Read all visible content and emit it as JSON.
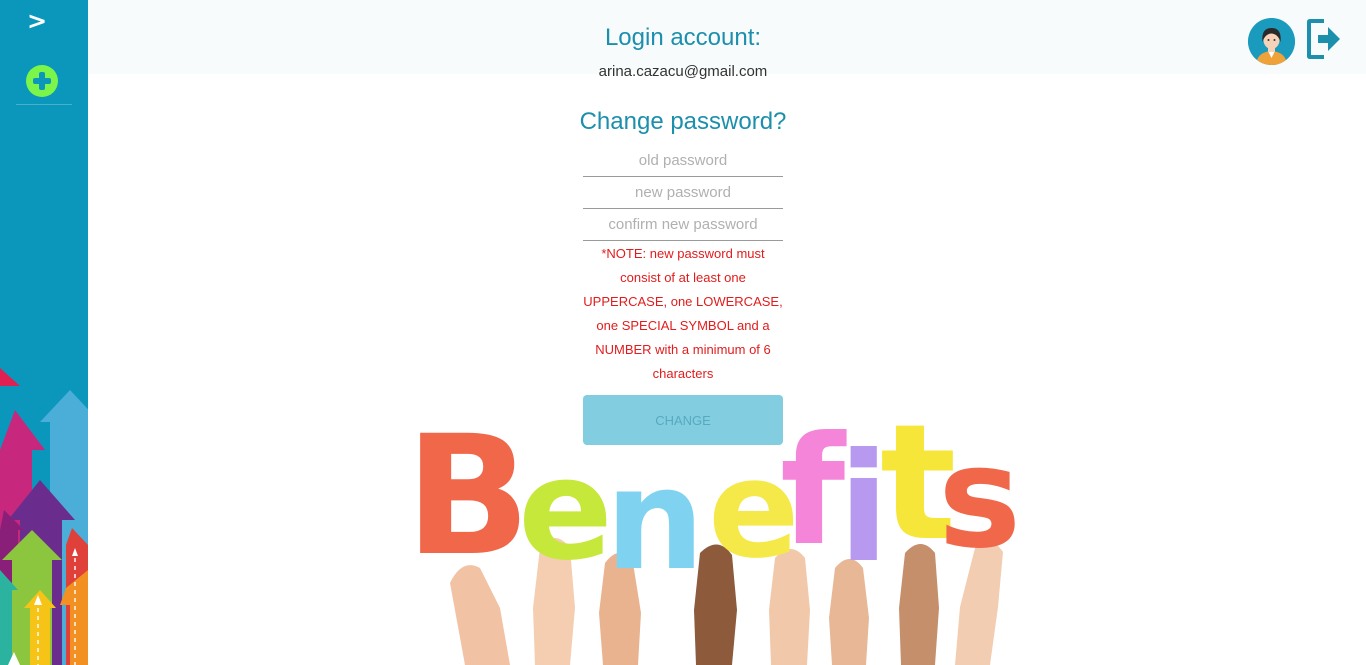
{
  "sidebar": {
    "toggle_label": ">",
    "add_icon": "plus-circle-icon",
    "colors": {
      "background": "#0a97bb",
      "add_button": "#7cf54a"
    }
  },
  "header": {
    "avatar_icon": "user-avatar-icon",
    "logout_icon": "logout-icon"
  },
  "account": {
    "login_title": "Login account:",
    "email": "arina.cazacu@gmail.com"
  },
  "change_password": {
    "title": "Change password?",
    "old_placeholder": "old password",
    "new_placeholder": "new password",
    "confirm_placeholder": "confirm new password",
    "note_lines": [
      "*NOTE: new password must",
      "consist of at least one",
      "UPPERCASE, one LOWERCASE,",
      "one SPECIAL SYMBOL and a",
      "NUMBER with a minimum of 6",
      "characters"
    ],
    "button_label": "CHANGE"
  },
  "illustration": {
    "word": "Benefits",
    "letters": [
      "B",
      "e",
      "n",
      "e",
      "f",
      "i",
      "t",
      "s"
    ],
    "colors": [
      "#f0674a",
      "#c6e83a",
      "#7fd3f0",
      "#f5e94a",
      "#f585d8",
      "#b79af0",
      "#f7e63a",
      "#f0674a"
    ]
  },
  "theme": {
    "accent": "#1c8fad",
    "note_color": "#e21c1c"
  }
}
